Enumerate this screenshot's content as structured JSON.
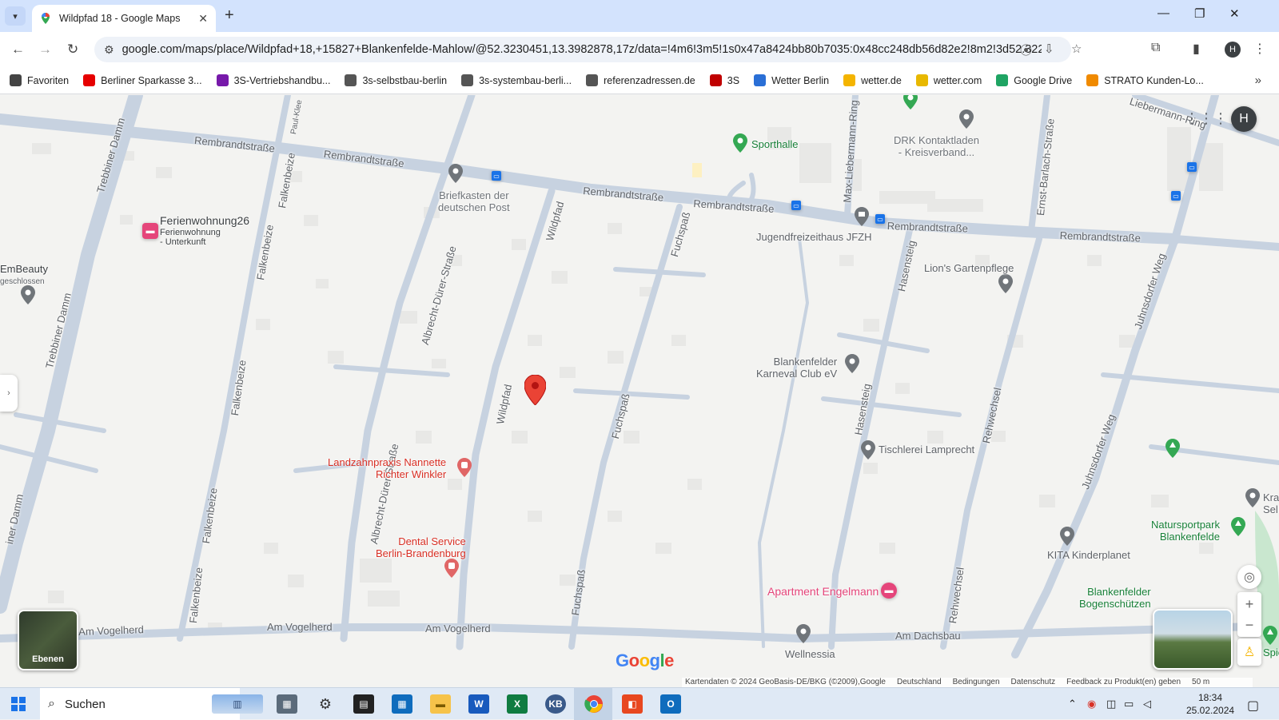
{
  "tab": {
    "title": "Wildpfad 18 - Google Maps"
  },
  "address_bar": {
    "url": "google.com/maps/place/Wildpfad+18,+15827+Blankenfelde-Mahlow/@52.3230451,13.3982878,17z/data=!4m6!3m5!1s0x47a8424bb80b7035:0x48cc248db56d82e2!8m2!3d52.3229607!4..."
  },
  "profile_initial": "H",
  "bookmarks": [
    {
      "label": "Favoriten",
      "icon": "folder-icon",
      "color": "#444444"
    },
    {
      "label": "Berliner Sparkasse 3...",
      "icon": "sparkasse-icon",
      "color": "#e60000"
    },
    {
      "label": "3S-Vertriebshandbu...",
      "icon": "onenote-icon",
      "color": "#7719aa"
    },
    {
      "label": "3s-selbstbau-berlin",
      "icon": "globe-icon",
      "color": "#555555"
    },
    {
      "label": "3s-systembau-berli...",
      "icon": "globe-icon",
      "color": "#555555"
    },
    {
      "label": "referenzadressen.de",
      "icon": "globe-icon",
      "color": "#555555"
    },
    {
      "label": "3S",
      "icon": "3s-icon",
      "color": "#c00000"
    },
    {
      "label": "Wetter Berlin",
      "icon": "weather-icon",
      "color": "#2a6fd6"
    },
    {
      "label": "wetter.de",
      "icon": "sun-icon",
      "color": "#f4b400"
    },
    {
      "label": "wetter.com",
      "icon": "wettercom-icon",
      "color": "#e8b800"
    },
    {
      "label": "Google Drive",
      "icon": "drive-icon",
      "color": "#1fa463"
    },
    {
      "label": "STRATO Kunden-Lo...",
      "icon": "strato-icon",
      "color": "#f08a00"
    }
  ],
  "map": {
    "streets": {
      "rembrandt1": "Rembrandtstraße",
      "rembrandt2": "Rembrandtstraße",
      "rembrandt3": "Rembrandtstraße",
      "rembrandt4": "Rembrandtstraße",
      "rembrandt5": "Rembrandtstraße",
      "rembrandt6": "Rembrandtstraße",
      "trebbiner1": "Trebbiner Damm",
      "trebbiner2": "Trebbiner Damm",
      "trebbiner3": "iner Damm",
      "falken1": "Falkenbeize",
      "falken2": "Falkenbeize",
      "falken3": "Falkenbeize",
      "falken4": "Falkenbeize",
      "falken5": "Falkenbeize",
      "albrecht1": "Albrecht-Dürer-Straße",
      "albrecht2": "Albrecht-Dürer-Straße",
      "wildpfad1": "Wildpfad",
      "wildpfad2": "Wildpfad",
      "fuchspass1": "Fuchspaß",
      "fuchspass2": "Fuchspaß",
      "fuchspass3": "Fuchspaß",
      "maxlieb": "Max-Liebermann-Ring",
      "hasen1": "Hasensteig",
      "hasen2": "Hasensteig",
      "ernst": "Ernst-Barlach-Straße",
      "reh1": "Rehwechsel",
      "reh2": "Rehwechsel",
      "juhns1": "Juhnsdorfer Weg",
      "juhns2": "Juhnsdorfer Weg",
      "lieb": "Liebermann-Ring",
      "vogel1": "Am Vogelherd",
      "vogel2": "Am Vogelherd",
      "vogel3": "Am Vogelherd",
      "dachsbau": "Am Dachsbau",
      "paulklee": "Paul-Klee"
    },
    "pois": {
      "briefkasten": "Briefkasten der\ndeutschen Post",
      "sporthalle": "Sporthalle",
      "drk": "DRK Kontaktladen\n- Kreisverband...",
      "jfzh": "Jugendfreizeithaus JFZH",
      "lion": "Lion's Gartenpflege",
      "ferienwohnung": "Ferienwohnung26",
      "ferienwohnung_sub": "Ferienwohnung\n- Unterkunft",
      "embeauty": "EmBeauty",
      "embeauty_sub": "geschlossen",
      "karneval": "Blankenfelder\nKarneval Club eV",
      "tischlerei": "Tischlerei Lamprecht",
      "landzahn": "Landzahnpraxis Nannette\nRichter Winkler",
      "dental": "Dental Service\nBerlin-Brandenburg",
      "apartment": "Apartment Engelmann",
      "wellnessia": "Wellnessia",
      "kita": "KITA Kinderplanet",
      "natursport": "Natursportpark\nBlankenfelde",
      "bogen": "Blankenfelder\nBogenschützen",
      "kra": "Kra\nSel",
      "spiel": "Spiel"
    },
    "layers_label": "Ebenen",
    "google_logo": "Google",
    "attribution": {
      "kartendaten": "Kartendaten © 2024 GeoBasis-DE/BKG (©2009),Google",
      "land": "Deutschland",
      "bedingungen": "Bedingungen",
      "datenschutz": "Datenschutz",
      "feedback": "Feedback zu Produkt(en) geben",
      "scale": "50 m"
    },
    "colors": {
      "road": "#c9d4e2",
      "road_edge": "#b6c3d4",
      "building": "#e6e6e6",
      "pin": "#ea4335",
      "poi_gray": "#70757a",
      "poi_green": "#34a853",
      "poi_red": "#d93025",
      "poi_pink": "#e5457a"
    }
  },
  "taskbar": {
    "search_label": "Suchen",
    "apps": [
      "calculator-icon",
      "settings-icon",
      "store-icon",
      "outlook-calendar-icon",
      "file-explorer-icon",
      "word-icon",
      "excel-icon",
      "kb-icon",
      "chrome-icon",
      "office-icon",
      "outlook-icon"
    ],
    "kb_label": "KB",
    "word_label": "W",
    "excel_label": "X",
    "time": "18:34",
    "date": "25.02.2024"
  }
}
